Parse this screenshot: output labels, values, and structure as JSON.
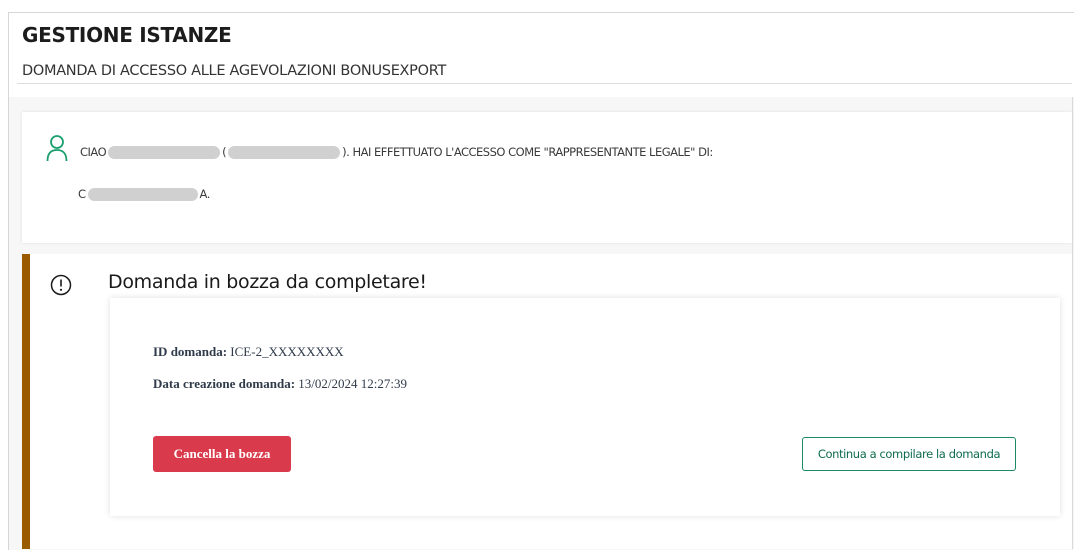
{
  "header": {
    "title": "GESTIONE ISTANZE",
    "subtitle": "DOMANDA DI ACCESSO ALLE AGEVOLAZIONI BONUSEXPORT"
  },
  "welcome": {
    "icon": "user-outline-icon",
    "greeting_start": "CIAO",
    "paren_open": "(",
    "paren_close": ").",
    "access_text": "HAI EFFETTUATO L'ACCESSO COME \"RAPPRESENTANTE LEGALE\" DI:",
    "company_start": "C",
    "company_end": "A.",
    "icon_color": "#1b9e6e"
  },
  "alert": {
    "icon": "exclamation-circle-icon",
    "title": "Domanda in bozza da completare!",
    "accent_color": "#9a5b00",
    "id_label": "ID domanda:",
    "id_value": "ICE-2_XXXXXXXX",
    "date_label": "Data creazione domanda:",
    "date_value": "13/02/2024 12:27:39",
    "delete_label": "Cancella la bozza",
    "delete_color": "#d93b4c",
    "continue_label": "Continua a compilare la domanda",
    "continue_color": "#1b8a63"
  }
}
